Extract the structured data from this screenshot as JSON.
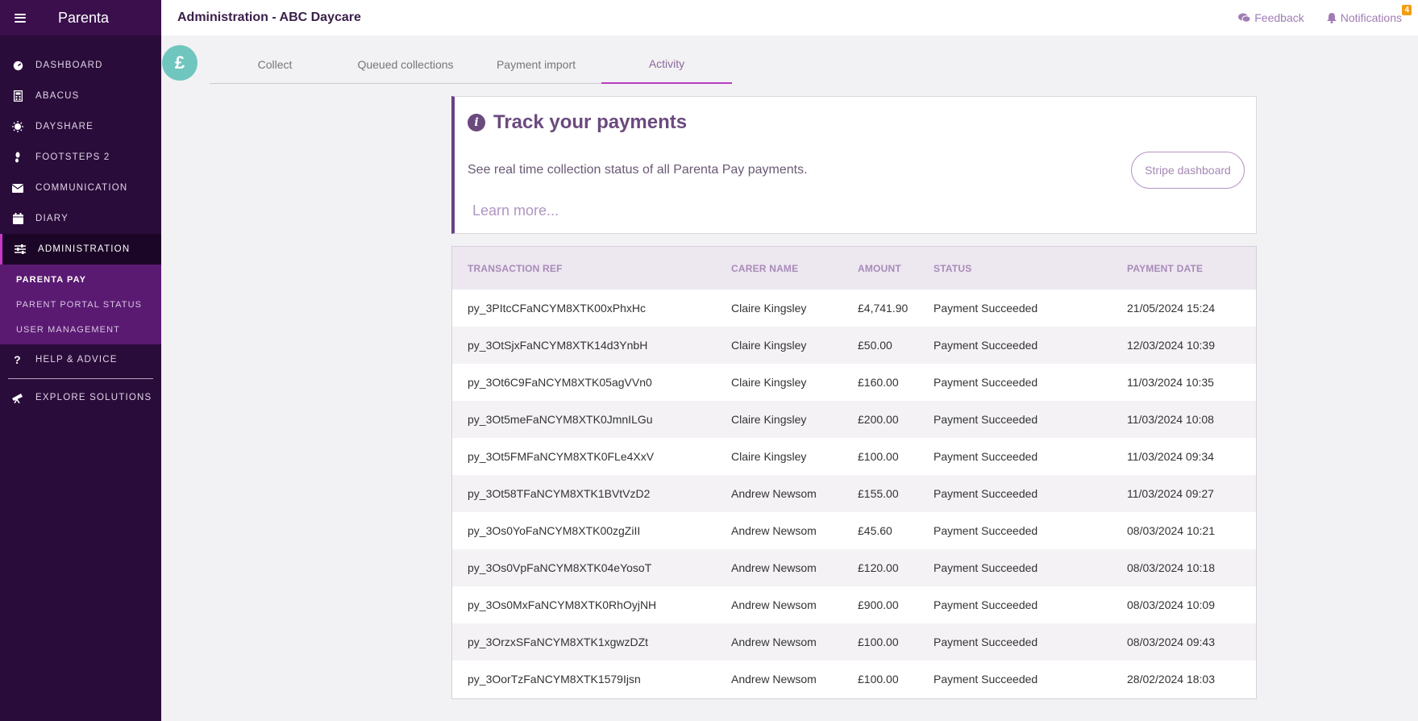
{
  "sidebar": {
    "brand": "Parenta",
    "items": [
      {
        "label": "DASHBOARD"
      },
      {
        "label": "ABACUS"
      },
      {
        "label": "DAYSHARE"
      },
      {
        "label": "FOOTSTEPS 2"
      },
      {
        "label": "COMMUNICATION"
      },
      {
        "label": "DIARY"
      },
      {
        "label": "ADMINISTRATION"
      }
    ],
    "subitems": [
      {
        "label": "PARENTA PAY"
      },
      {
        "label": "PARENT PORTAL STATUS"
      },
      {
        "label": "USER MANAGEMENT"
      }
    ],
    "help": "HELP & ADVICE",
    "explore": "EXPLORE SOLUTIONS"
  },
  "header": {
    "title": "Administration - ABC Daycare",
    "feedback": "Feedback",
    "notifications": "Notifications",
    "notification_count": "4"
  },
  "tabs": {
    "pound_symbol": "£",
    "items": [
      "Collect",
      "Queued collections",
      "Payment import",
      "Activity"
    ]
  },
  "info": {
    "title": "Track your payments",
    "icon_glyph": "i",
    "text": "See real time collection status of all Parenta Pay payments.",
    "learn_more": "Learn more...",
    "stripe_button": "Stripe dashboard"
  },
  "table": {
    "headers": [
      "TRANSACTION REF",
      "CARER NAME",
      "AMOUNT",
      "STATUS",
      "PAYMENT DATE"
    ],
    "rows": [
      [
        "py_3PItcCFaNCYM8XTK00xPhxHc",
        "Claire Kingsley",
        "£4,741.90",
        "Payment Succeeded",
        "21/05/2024 15:24"
      ],
      [
        "py_3OtSjxFaNCYM8XTK14d3YnbH",
        "Claire Kingsley",
        "£50.00",
        "Payment Succeeded",
        "12/03/2024 10:39"
      ],
      [
        "py_3Ot6C9FaNCYM8XTK05agVVn0",
        "Claire Kingsley",
        "£160.00",
        "Payment Succeeded",
        "11/03/2024 10:35"
      ],
      [
        "py_3Ot5meFaNCYM8XTK0JmnILGu",
        "Claire Kingsley",
        "£200.00",
        "Payment Succeeded",
        "11/03/2024 10:08"
      ],
      [
        "py_3Ot5FMFaNCYM8XTK0FLe4XxV",
        "Claire Kingsley",
        "£100.00",
        "Payment Succeeded",
        "11/03/2024 09:34"
      ],
      [
        "py_3Ot58TFaNCYM8XTK1BVtVzD2",
        "Andrew Newsom",
        "£155.00",
        "Payment Succeeded",
        "11/03/2024 09:27"
      ],
      [
        "py_3Os0YoFaNCYM8XTK00zgZiII",
        "Andrew Newsom",
        "£45.60",
        "Payment Succeeded",
        "08/03/2024 10:21"
      ],
      [
        "py_3Os0VpFaNCYM8XTK04eYosoT",
        "Andrew Newsom",
        "£120.00",
        "Payment Succeeded",
        "08/03/2024 10:18"
      ],
      [
        "py_3Os0MxFaNCYM8XTK0RhOyjNH",
        "Andrew Newsom",
        "£900.00",
        "Payment Succeeded",
        "08/03/2024 10:09"
      ],
      [
        "py_3OrzxSFaNCYM8XTK1xgwzDZt",
        "Andrew Newsom",
        "£100.00",
        "Payment Succeeded",
        "08/03/2024 09:43"
      ],
      [
        "py_3OorTzFaNCYM8XTK1579Ijsn",
        "Andrew Newsom",
        "£100.00",
        "Payment Succeeded",
        "28/02/2024 18:03"
      ]
    ]
  }
}
